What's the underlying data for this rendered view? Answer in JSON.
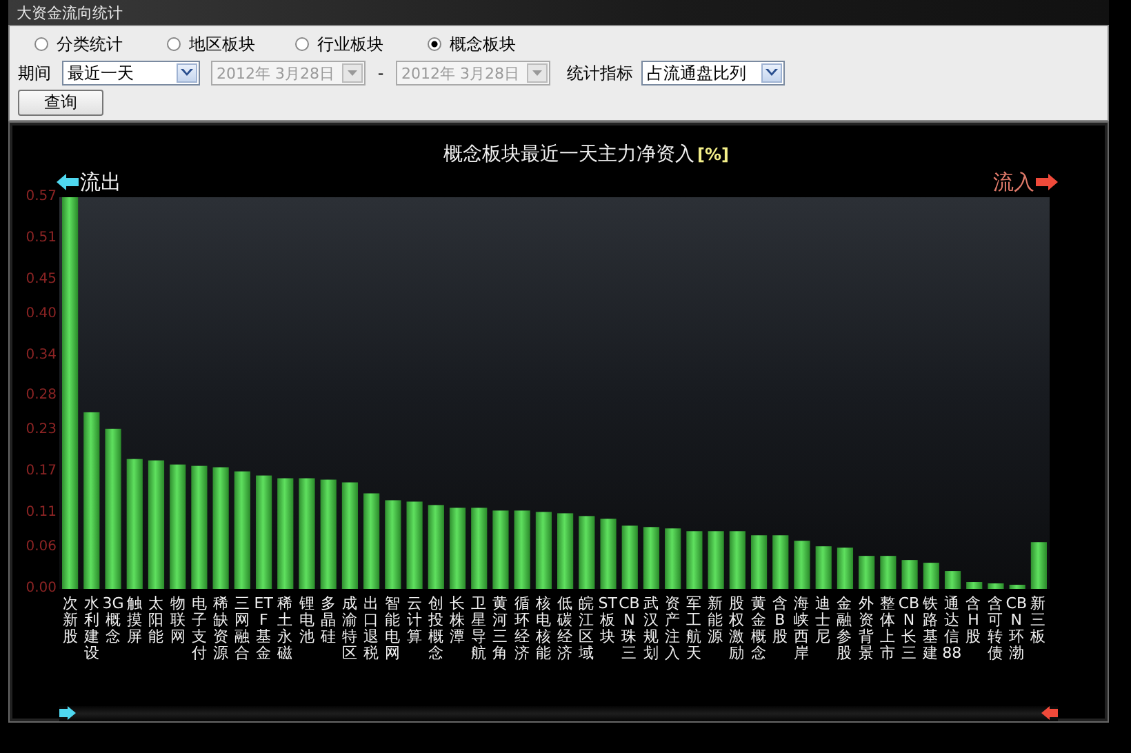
{
  "window": {
    "title": "大资金流向统计"
  },
  "radio_options": [
    {
      "label": "分类统计",
      "selected": false
    },
    {
      "label": "地区板块",
      "selected": false
    },
    {
      "label": "行业板块",
      "selected": false
    },
    {
      "label": "概念板块",
      "selected": true
    }
  ],
  "period": {
    "label": "期间",
    "value": "最近一天"
  },
  "date_from": {
    "value": "2012年  3月28日",
    "disabled": true
  },
  "date_separator": "-",
  "date_to": {
    "value": "2012年  3月28日",
    "disabled": true
  },
  "metric": {
    "label": "统计指标",
    "value": "占流通盘比列"
  },
  "query_button": "查询",
  "chart": {
    "outflow_label": "流出",
    "inflow_label": "流入",
    "unit": "[%]",
    "chart_data": {
      "type": "bar",
      "title": "概念板块最近一天主力净资入",
      "categories": [
        "次新股",
        "水利建设",
        "3G概念",
        "触摸屏",
        "太阳能",
        "物联网",
        "电子支付",
        "稀缺资源",
        "三网融合",
        "ETF基金",
        "稀土永磁",
        "锂电池",
        "多晶硅",
        "成渝特区",
        "出口退税",
        "智能电网",
        "云计算",
        "创投概念",
        "长株潭",
        "卫星导航",
        "黄河三角",
        "循环经济",
        "核电核能",
        "低碳经济",
        "皖江区域",
        "ST板块",
        "CBN珠三",
        "武汉规划",
        "资产注入",
        "军工航天",
        "新能源",
        "股权激励",
        "黄金概念",
        "含B股",
        "海峡西岸",
        "迪士尼",
        "金融参股",
        "外资背景",
        "整体上市",
        "CBN长三",
        "铁路基建",
        "通达信88",
        "含H股",
        "含可转债",
        "CBN环渤",
        "新三板"
      ],
      "values": [
        0.57,
        0.257,
        0.233,
        0.189,
        0.187,
        0.181,
        0.179,
        0.177,
        0.171,
        0.165,
        0.161,
        0.161,
        0.159,
        0.155,
        0.139,
        0.129,
        0.127,
        0.122,
        0.118,
        0.118,
        0.114,
        0.114,
        0.112,
        0.11,
        0.106,
        0.102,
        0.092,
        0.09,
        0.088,
        0.084,
        0.084,
        0.084,
        0.078,
        0.078,
        0.07,
        0.062,
        0.06,
        0.048,
        0.048,
        0.042,
        0.038,
        0.026,
        0.01,
        0.008,
        0.006,
        0.068
      ],
      "ylim": [
        0,
        0.57
      ],
      "yticks": [
        {
          "value": 0,
          "label": "0.00"
        },
        {
          "value": 0.06,
          "label": "0.06"
        },
        {
          "value": 0.11,
          "label": "0.11"
        },
        {
          "value": 0.17,
          "label": "0.17"
        },
        {
          "value": 0.23,
          "label": "0.23"
        },
        {
          "value": 0.28,
          "label": "0.28"
        },
        {
          "value": 0.34,
          "label": "0.34"
        },
        {
          "value": 0.4,
          "label": "0.40"
        },
        {
          "value": 0.45,
          "label": "0.45"
        },
        {
          "value": 0.51,
          "label": "0.51"
        },
        {
          "value": 0.57,
          "label": "0.57"
        }
      ]
    }
  }
}
